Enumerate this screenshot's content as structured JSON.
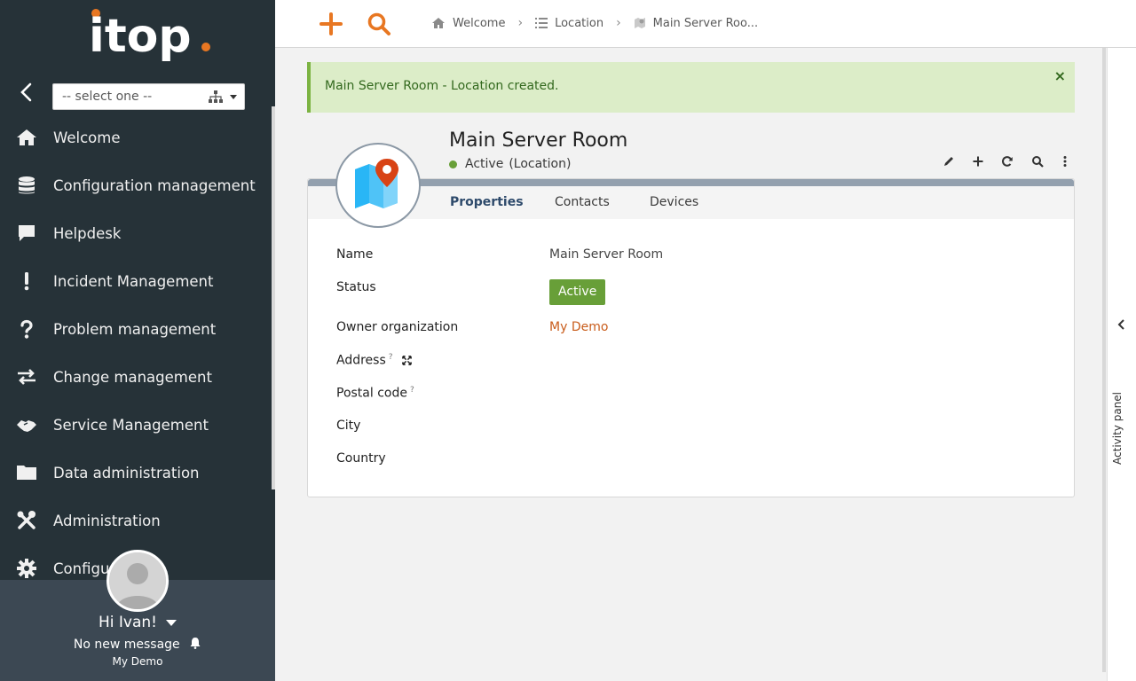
{
  "sidebar": {
    "logo_text": "itop",
    "org_select_placeholder": "-- select one --",
    "menu": [
      {
        "label": "Welcome",
        "icon": "home-icon"
      },
      {
        "label": "Configuration management",
        "icon": "database-icon"
      },
      {
        "label": "Helpdesk",
        "icon": "speech-bubble-icon"
      },
      {
        "label": "Incident Management",
        "icon": "exclamation-icon"
      },
      {
        "label": "Problem management",
        "icon": "question-icon"
      },
      {
        "label": "Change management",
        "icon": "exchange-arrows-icon"
      },
      {
        "label": "Service Management",
        "icon": "handshake-icon"
      },
      {
        "label": "Data administration",
        "icon": "folder-icon"
      },
      {
        "label": "Administration",
        "icon": "tools-icon"
      },
      {
        "label": "Configur",
        "icon": "gear-icon"
      }
    ],
    "user": {
      "greeting": "Hi Ivan!",
      "messages": "No new message",
      "organization": "My Demo"
    }
  },
  "topbar": {
    "breadcrumbs": [
      {
        "label": "Welcome",
        "icon": "home-icon"
      },
      {
        "label": "Location",
        "icon": "list-icon"
      },
      {
        "label": "Main Server Roo...",
        "icon": "location-icon"
      }
    ]
  },
  "alert": {
    "message": "Main Server Room - Location created.",
    "close": "×"
  },
  "object": {
    "title": "Main Server Room",
    "status": "Active",
    "class": "(Location)"
  },
  "tabs": [
    "Properties",
    "Contacts",
    "Devices"
  ],
  "fields": {
    "name_label": "Name",
    "name_value": "Main Server Room",
    "status_label": "Status",
    "status_value": "Active",
    "owner_label": "Owner organization",
    "owner_value": "My Demo",
    "address_label": "Address",
    "postal_label": "Postal code",
    "city_label": "City",
    "country_label": "Country",
    "help_mark": "?"
  },
  "activity_panel": {
    "label": "Activity panel"
  },
  "colors": {
    "sidebar_bg": "#263238",
    "accent_orange": "#e87722",
    "status_green": "#689f38",
    "link_orange": "#c95d1c",
    "alert_bg": "#dcedc8"
  }
}
